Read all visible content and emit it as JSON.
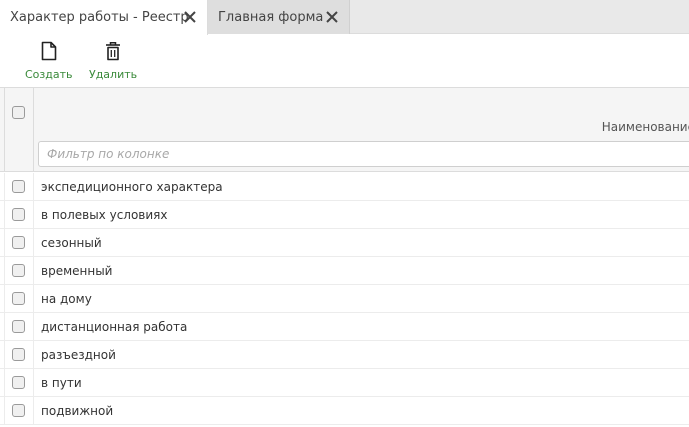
{
  "tabs": [
    {
      "label": "Характер работы - Реестр",
      "active": true
    },
    {
      "label": "Главная форма",
      "active": false
    }
  ],
  "toolbar": {
    "create_label": "Создать",
    "delete_label": "Удалить"
  },
  "grid": {
    "column_header": "Наименование",
    "filter_placeholder": "Фильтр по колонке",
    "rows": [
      "экспедиционного характера",
      "в полевых условиях",
      "сезонный",
      "временный",
      "на дому",
      "дистанционная работа",
      "разъездной",
      "в пути",
      "подвижной"
    ]
  },
  "colors": {
    "accent_green": "#3a8a3a",
    "tabbar_bg": "#e9e9e9",
    "header_bg": "#f5f5f5"
  }
}
